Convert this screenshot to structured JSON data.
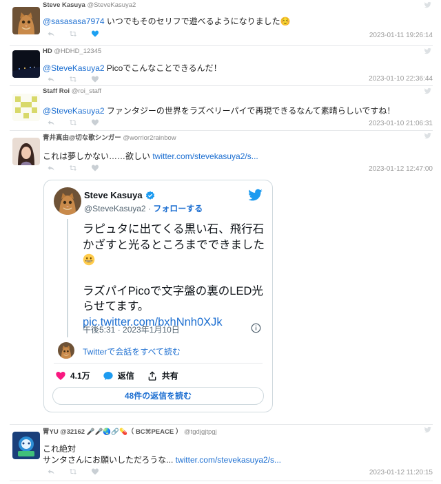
{
  "colors": {
    "link": "#1d6fd1",
    "heart": "#f91880",
    "liked": "#1da1f2"
  },
  "tweets": [
    {
      "name": "Steve Kasuya",
      "handle": "@SteveKasuya2",
      "mention": "@sasasasa7974",
      "text": " いつでもそのセリフで遊べるようになりました☺️",
      "timestamp": "2023-01-11 19:26:14"
    },
    {
      "name": "HD",
      "handle": "@HDHD_12345",
      "mention": "@SteveKasuya2",
      "text": " Picoでこんなことできるんだ！",
      "timestamp": "2023-01-10 22:36:44"
    },
    {
      "name": "Staff Roi",
      "handle": "@roi_staff",
      "mention": "@SteveKasuya2",
      "text": " ファンタジーの世界をラズベリーパイで再現できるなんて素晴らしいですね！",
      "timestamp": "2023-01-10 21:06:31"
    },
    {
      "name": "青井真由@切な歌シンガー",
      "handle": "@worrior2rainbow",
      "text": "これは夢しかない……欲しい ",
      "link": "twitter.com/stevekasuya2/s...",
      "timestamp": "2023-01-12 12:47:00"
    },
    {
      "name": "胃YU @32162 🎤🎤🌏🔗💊（ BC⌘PEACE ）",
      "handle": "@tgdjgjtpgj",
      "line1": "これ絶対",
      "line2": "サンタさんにお願いしただろうな... ",
      "link": "twitter.com/stevekasuya2/s...",
      "timestamp": "2023-01-12 11:20:15"
    }
  ],
  "embed": {
    "name": "Steve Kasuya",
    "handle": "@SteveKasuya2",
    "separator": " · ",
    "follow": "フォローする",
    "paragraph1": "ラピュタに出てくる黒い石、飛行石かざすと光るところまでできました",
    "paragraph2": "ラズパイPicoで文字盤の裏のLED光らせてます。",
    "pic_link": "pic.twitter.com/bxhNnh0XJk",
    "time": "午後5:31 · 2023年1月10日",
    "read_all": "Twitterで会話をすべて読む",
    "likes": "4.1万",
    "reply": "返信",
    "share": "共有",
    "read_replies": "48件の返信を読む"
  }
}
